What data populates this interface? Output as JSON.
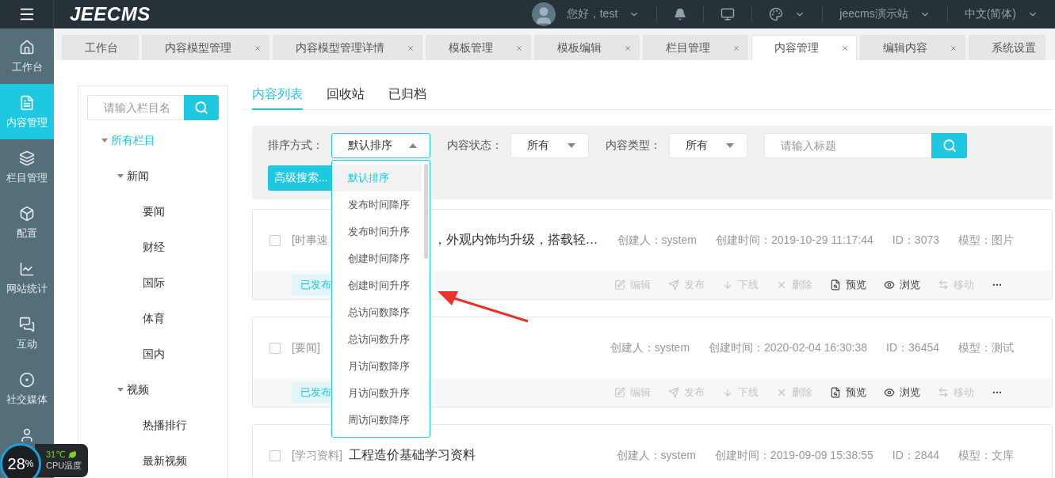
{
  "topbar": {
    "logo": "JEECMS",
    "greeting": "您好，test",
    "site": "jeecms演示站",
    "language": "中文(简体)"
  },
  "nav": [
    {
      "kind": "home",
      "label": "工作台",
      "selected": false
    },
    {
      "kind": "doc",
      "label": "内容管理",
      "selected": true
    },
    {
      "kind": "layers",
      "label": "栏目管理",
      "selected": false
    },
    {
      "kind": "box",
      "label": "配置",
      "selected": false
    },
    {
      "kind": "chart",
      "label": "网站统计",
      "selected": false
    },
    {
      "kind": "chat",
      "label": "互动",
      "selected": false
    },
    {
      "kind": "orbit",
      "label": "社交媒体",
      "selected": false
    },
    {
      "kind": "user",
      "selected": false
    }
  ],
  "tabs": [
    {
      "label": "工作台",
      "closable": false,
      "selected": false
    },
    {
      "label": "内容模型管理",
      "closable": true,
      "selected": false
    },
    {
      "label": "内容模型管理详情",
      "closable": true,
      "selected": false
    },
    {
      "label": "模板管理",
      "closable": true,
      "selected": false
    },
    {
      "label": "模板编辑",
      "closable": true,
      "selected": false
    },
    {
      "label": "栏目管理",
      "closable": true,
      "selected": false
    },
    {
      "label": "内容管理",
      "closable": true,
      "selected": true
    },
    {
      "label": "编辑内容",
      "closable": true,
      "selected": false
    },
    {
      "label": "系统设置",
      "closable": false,
      "selected": false
    }
  ],
  "tree": {
    "search_placeholder": "请输入栏目名",
    "items": [
      {
        "label": "所有栏目",
        "selected": true,
        "expanded": true,
        "children": [
          {
            "label": "新闻",
            "selected": false,
            "expanded": true,
            "children": [
              {
                "label": "要闻",
                "selected": false
              },
              {
                "label": "财经",
                "selected": false
              },
              {
                "label": "国际",
                "selected": false
              },
              {
                "label": "体育",
                "selected": false
              },
              {
                "label": "国内",
                "selected": false
              }
            ]
          },
          {
            "label": "视频",
            "selected": false,
            "expanded": true,
            "children": [
              {
                "label": "热播排行",
                "selected": false
              },
              {
                "label": "最新视频",
                "selected": false
              }
            ]
          }
        ]
      }
    ]
  },
  "subtabs": [
    {
      "label": "内容列表",
      "selected": true
    },
    {
      "label": "回收站",
      "selected": false
    },
    {
      "label": "已归档",
      "selected": false
    }
  ],
  "filters": [
    {
      "label": "排序方式：",
      "value": "默认排序",
      "open": true
    },
    {
      "label": "内容状态：",
      "value": "所有",
      "open": false
    },
    {
      "label": "内容类型：",
      "value": "所有",
      "open": false
    }
  ],
  "title_search": {
    "placeholder": "请输入标题"
  },
  "advanced_button": "高级搜索...",
  "sort_options": [
    {
      "label": "默认排序",
      "selected": true
    },
    {
      "label": "发布时间降序",
      "selected": false
    },
    {
      "label": "发布时间升序",
      "selected": false
    },
    {
      "label": "创建时间降序",
      "selected": false
    },
    {
      "label": "创建时间升序",
      "selected": false
    },
    {
      "label": "总访问数降序",
      "selected": false
    },
    {
      "label": "总访问数升序",
      "selected": false
    },
    {
      "label": "月访问数降序",
      "selected": false
    },
    {
      "label": "月访问数升序",
      "selected": false
    },
    {
      "label": "周访问数降序",
      "selected": false
    }
  ],
  "cards": [
    {
      "checked": false,
      "category": "[时事速",
      "title": "，外观内饰均升级，搭载轻…",
      "title_covered": true,
      "meta": [
        "创建人：system",
        "创建时间：2019-10-29 11:17:44",
        "ID：3073",
        "模型：图片"
      ],
      "status": "已发布",
      "actions": [
        {
          "kind": "edit",
          "label": "编辑",
          "disabled": true
        },
        {
          "kind": "send",
          "label": "发布",
          "disabled": true
        },
        {
          "kind": "down",
          "label": "下线",
          "disabled": true
        },
        {
          "kind": "x",
          "label": "删除",
          "disabled": true
        },
        {
          "kind": "preview",
          "label": "预览",
          "disabled": false
        },
        {
          "kind": "eye",
          "label": "浏览",
          "disabled": false
        },
        {
          "kind": "move",
          "label": "移动",
          "disabled": true
        },
        {
          "kind": "more",
          "disabled": false
        }
      ]
    },
    {
      "checked": false,
      "category": "[要闻]",
      "meta": [
        "创建人：system",
        "创建时间：2020-02-04 16:30:38",
        "ID：36454",
        "模型：测试"
      ],
      "status": "已发布",
      "actions": [
        {
          "kind": "edit",
          "label": "编辑",
          "disabled": true
        },
        {
          "kind": "send",
          "label": "发布",
          "disabled": true
        },
        {
          "kind": "down",
          "label": "下线",
          "disabled": true
        },
        {
          "kind": "x",
          "label": "删除",
          "disabled": true
        },
        {
          "kind": "preview",
          "label": "预览",
          "disabled": false
        },
        {
          "kind": "eye",
          "label": "浏览",
          "disabled": false
        },
        {
          "kind": "move",
          "label": "移动",
          "disabled": true
        },
        {
          "kind": "more",
          "disabled": false
        }
      ]
    },
    {
      "checked": false,
      "category": "[学习资料]",
      "title": "工程造价基础学习资料",
      "title_covered": false,
      "meta": [
        "创建人：system",
        "创建时间：2019-09-09 15:38:55",
        "ID：2844",
        "模型：文库"
      ]
    }
  ],
  "cpu_widget": {
    "percent": "28",
    "unit": "%",
    "temperature": "31℃",
    "label": "CPU温度"
  }
}
